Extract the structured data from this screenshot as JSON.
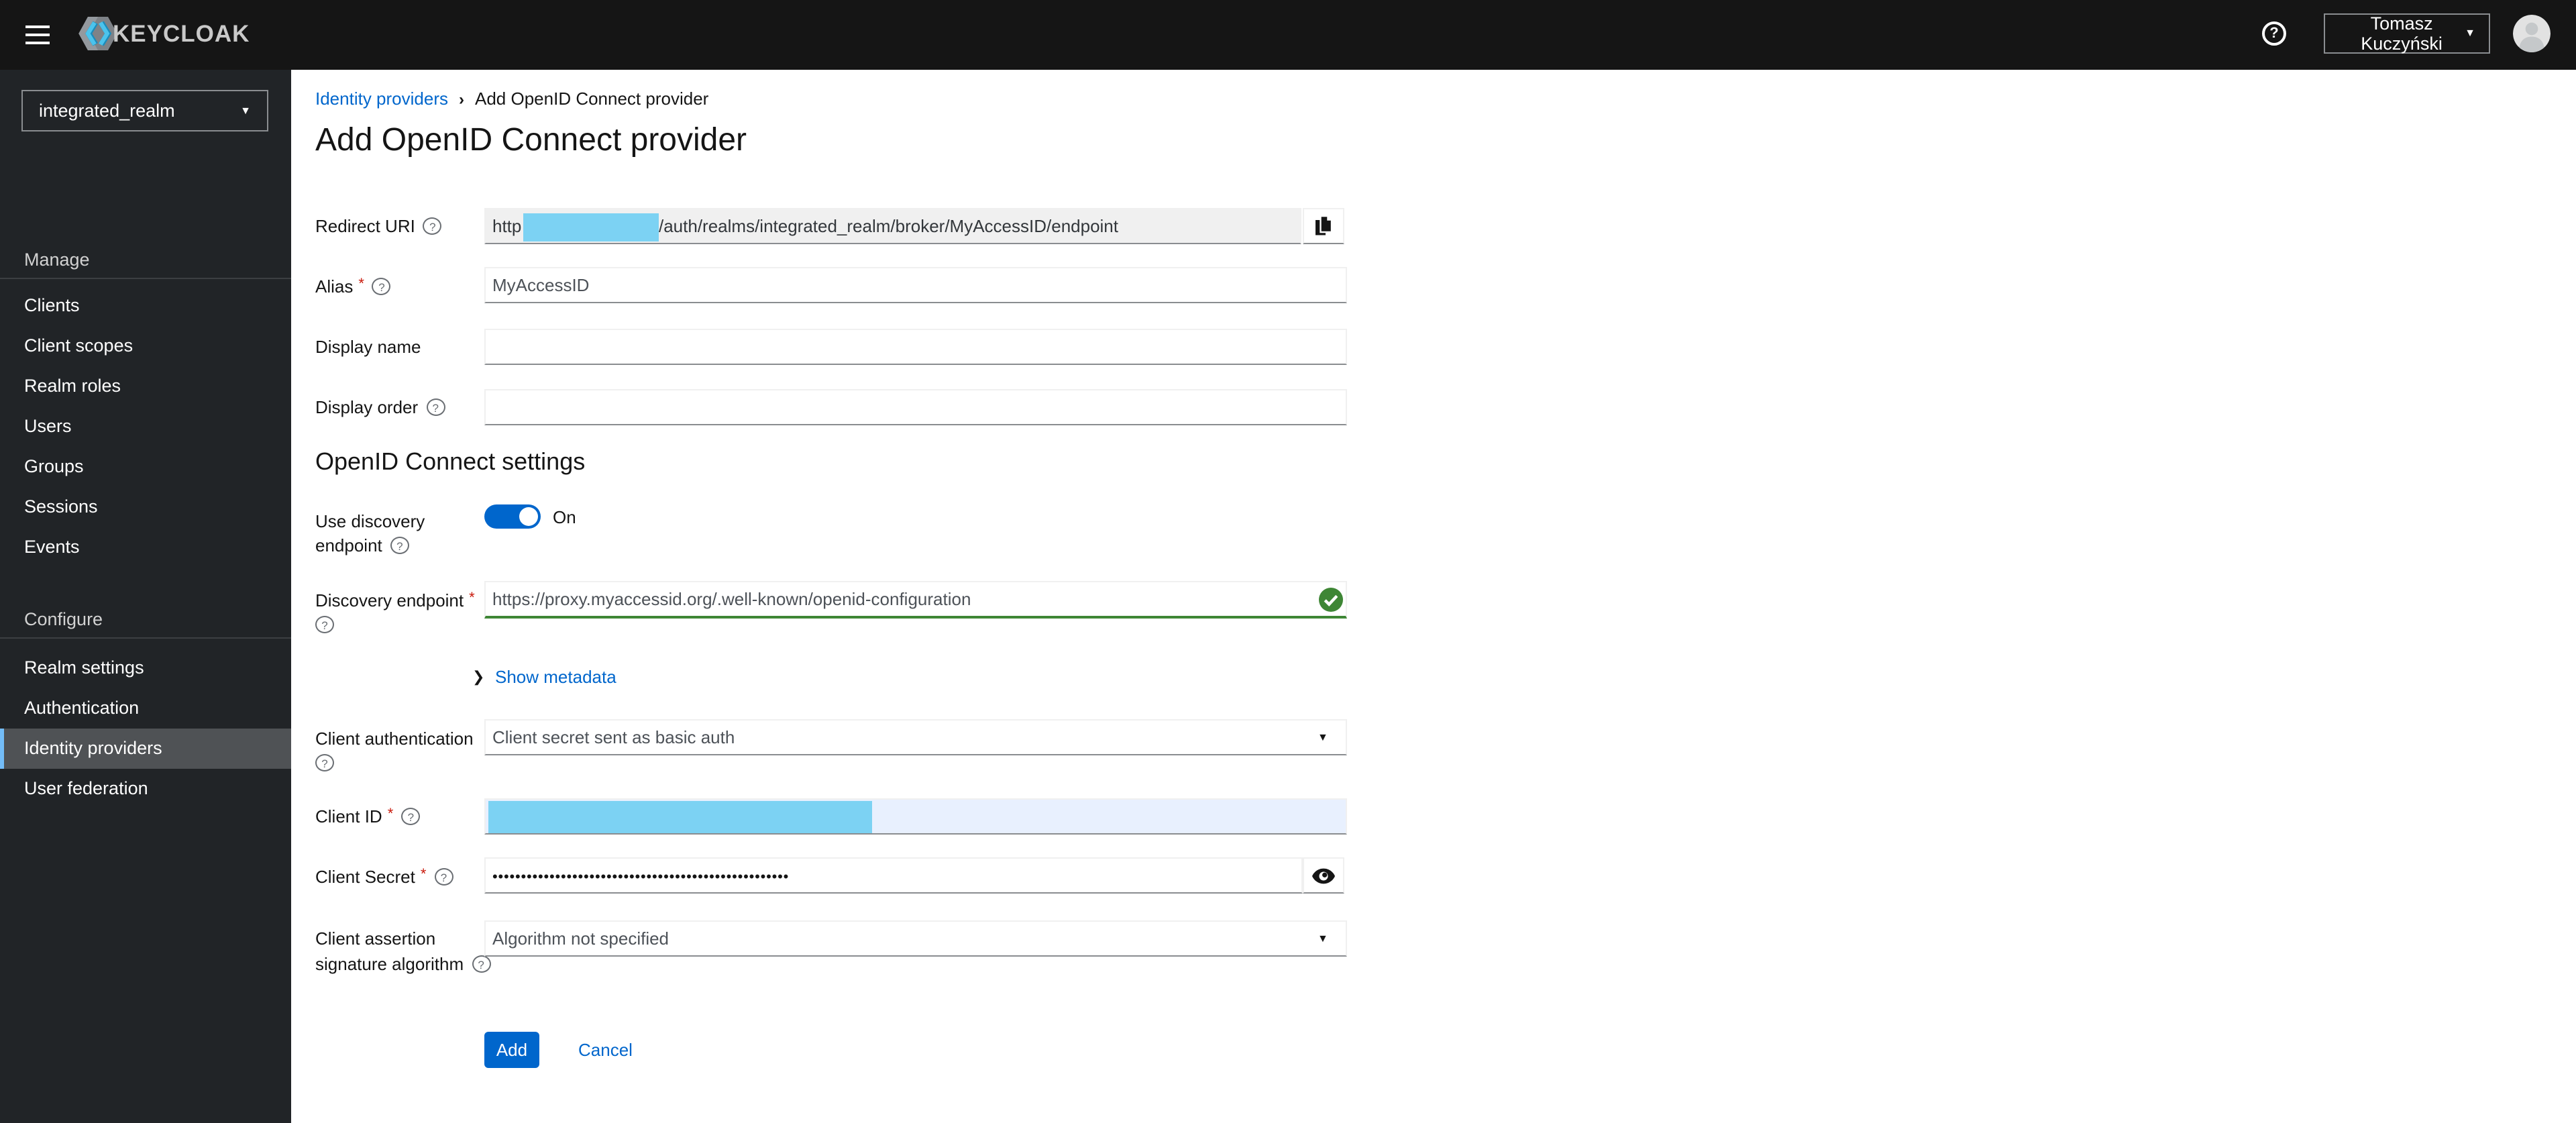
{
  "icons": {
    "help": "?",
    "caret_down": "▼",
    "angle_right": "›",
    "expand_chevron": "❯"
  },
  "colors": {
    "accent_blue": "#0066cc",
    "success_green": "#3e8635",
    "redaction_blue": "#7cd2f3",
    "autofill_field_blue": "#e8f0fe",
    "selected_nav_border": "#73bcf7",
    "masthead_bg": "#151515",
    "sidebar_bg": "#212427"
  },
  "masthead": {
    "brand": "KEYCLOAK",
    "user_name": "Tomasz Kuczyński"
  },
  "sidebar": {
    "realm": "integrated_realm",
    "manage": {
      "title": "Manage",
      "items": [
        "Clients",
        "Client scopes",
        "Realm roles",
        "Users",
        "Groups",
        "Sessions",
        "Events"
      ]
    },
    "configure": {
      "title": "Configure",
      "items": [
        "Realm settings",
        "Authentication",
        "Identity providers",
        "User federation"
      ],
      "selected": "Identity providers"
    }
  },
  "breadcrumb": {
    "link": "Identity providers",
    "current": "Add OpenID Connect provider"
  },
  "page_title": "Add OpenID Connect provider",
  "form": {
    "redirect_uri": {
      "label": "Redirect URI",
      "value_prefix": "http",
      "value_suffix": "/auth/realms/integrated_realm/broker/MyAccessID/endpoint"
    },
    "alias": {
      "label": "Alias",
      "value": "MyAccessID"
    },
    "display_name": {
      "label": "Display name",
      "value": ""
    },
    "display_order": {
      "label": "Display order",
      "value": ""
    },
    "section_title": "OpenID Connect settings",
    "use_discovery": {
      "label_line1": "Use discovery",
      "label_line2": "endpoint",
      "state_label": "On"
    },
    "discovery_endpoint": {
      "label": "Discovery endpoint",
      "value": "https://proxy.myaccessid.org/.well-known/openid-configuration"
    },
    "show_metadata_label": "Show metadata",
    "client_authentication": {
      "label": "Client authentication",
      "value": "Client secret sent as basic auth"
    },
    "client_id": {
      "label": "Client ID",
      "value": ""
    },
    "client_secret": {
      "label": "Client Secret",
      "masked_value": "••••••••••••••••••••••••••••••••••••••••••••••••••••"
    },
    "client_assertion": {
      "label_line1": "Client assertion",
      "label_line2": "signature algorithm",
      "value": "Algorithm not specified"
    },
    "add_label": "Add",
    "cancel_label": "Cancel"
  }
}
